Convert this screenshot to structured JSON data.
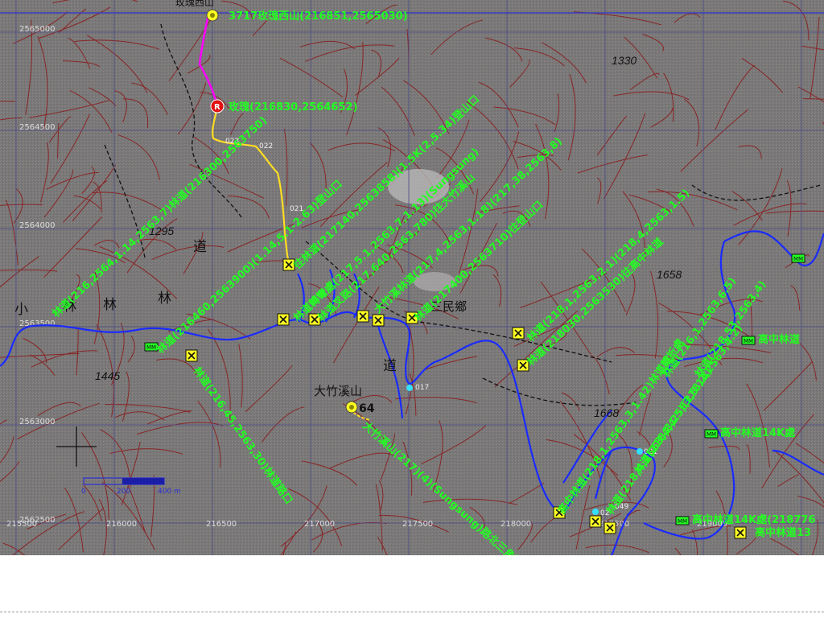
{
  "map": {
    "grid_labels": {
      "northing": [
        "2565000",
        "2564500",
        "2564000",
        "2563500",
        "2563000",
        "2562500"
      ],
      "easting": [
        "215500",
        "216000",
        "216500",
        "217000",
        "217500",
        "218000",
        "218500",
        "219000"
      ]
    },
    "scale_bar": {
      "labels": [
        "0",
        "200",
        "400 m"
      ]
    },
    "elevations": [
      "1330",
      "1295",
      "1658",
      "1445",
      "1668"
    ],
    "place_names": {
      "peak_top": "玫瑰西山",
      "township": "三民鄉",
      "mountain": "大竹溪山",
      "mountain_elev": "64",
      "road_char_1": "道",
      "road_char_2": "林",
      "road_char_3": "小",
      "road_char_4": "林",
      "road_char_5": "林",
      "road_char_6": "道"
    },
    "route_points": {
      "p1": "023",
      "p2": "022",
      "p3": "021",
      "p4": "017",
      "p5": "021",
      "p6": "049",
      "p7": "02"
    },
    "annotations": {
      "top_peak": "3717玫瑰西山(216851,2565030)",
      "r_point": "玫瑰(216830,2564652)",
      "road_right": "高中林道",
      "road_right2": "高中林道14K處",
      "road_right3": "高中林道14K處(218776",
      "road_right4": "高中林道13",
      "trail_bottom": "大竹溪山(217)(4)(Sungsung)路北三角點",
      "diag_1": "林道(216,2564,1.14,2563,7)林道(216300,2563750)",
      "diag_2": "林道(216460,2563900)(1.14,5.1-2.63)登山口",
      "diag_3": "往林道(217140,2563858)(1.5K(2,5.34)登山口",
      "diag_4": "林道轉彎處(217,5.1,2563,7,1.13)(Sungsung)",
      "diag_5": "林道叉路(217,640,2563,780)往大竹溪山",
      "diag_6": "大竹溪林道(217,4,2563,1.18)(217,38,2563,8)",
      "diag_7": "林道(217400,2563710)往登山口",
      "diag_8": "林道(218,1,2563,2.1)(218,4,2563,1.5)",
      "diag_9": "林道(218030,2563530)往高中林道",
      "diag_10": "高中林道(218,1,2563,3,1.42)林道轉折處",
      "diag_11": "林道(218,4,2563,4,4.5)(218,2,2563,4.2)",
      "diag_12": "林道(218,8,2563,5.14)",
      "diag_13": "林道(216,1,2563,6.5)",
      "diag_14": "林道(218,53,2563,4)",
      "diag_15": "林道(216,45,2563,30)林道路口"
    }
  },
  "colors": {
    "map_bg": "#7d7a7a",
    "contour": "#8a1d1d",
    "river": "#1a2bff",
    "route_magenta": "#ff00ff",
    "route_yellow": "#ffdd22",
    "label_green": "#22ff22",
    "marker_yellow": "#ffff22"
  }
}
